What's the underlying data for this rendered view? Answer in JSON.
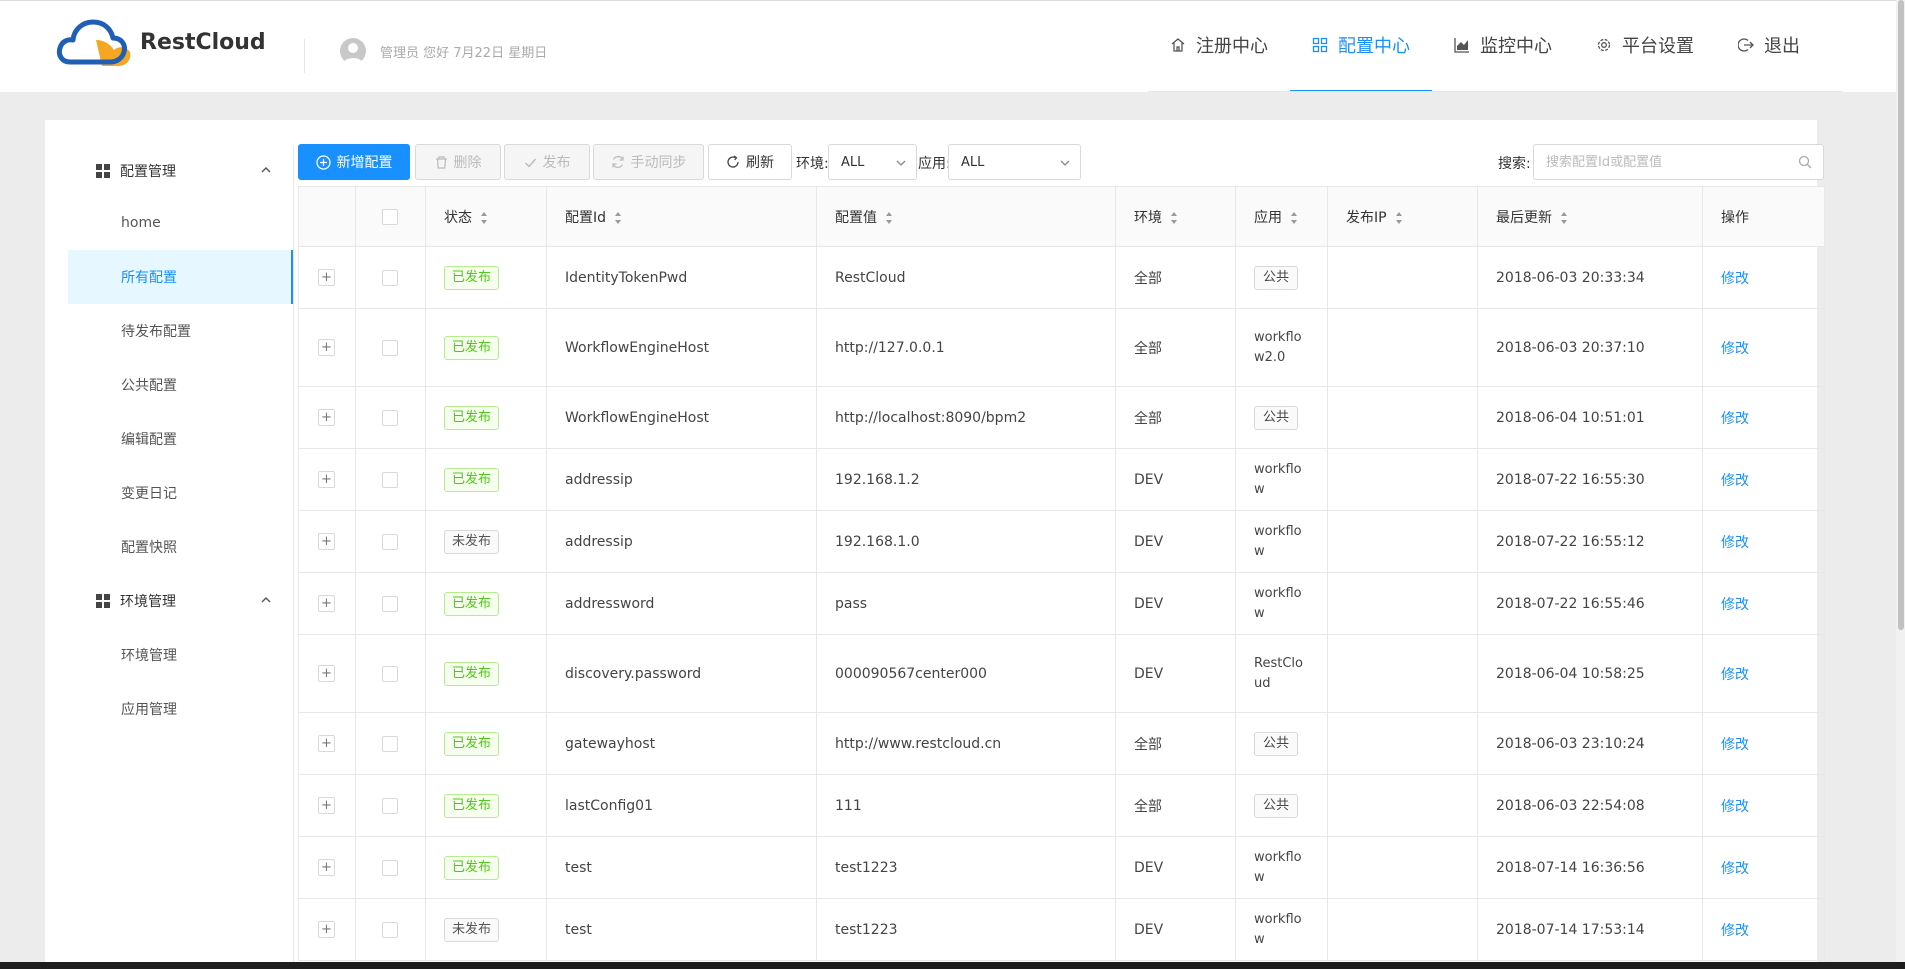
{
  "header": {
    "logo_text": "RestCloud",
    "greeting": "管理员 您好 7月22日 星期日",
    "nav": [
      {
        "label": "注册中心",
        "icon": "home-icon"
      },
      {
        "label": "配置中心",
        "icon": "appstore-icon",
        "active": true
      },
      {
        "label": "监控中心",
        "icon": "area-chart-icon"
      },
      {
        "label": "平台设置",
        "icon": "gear-icon"
      },
      {
        "label": "退出",
        "icon": "logout-icon"
      }
    ]
  },
  "sidebar": {
    "groups": [
      {
        "label": "配置管理",
        "icon": "appstore-icon",
        "items": [
          "home",
          "所有配置",
          "待发布配置",
          "公共配置",
          "编辑配置",
          "变更日记",
          "配置快照"
        ]
      },
      {
        "label": "环境管理",
        "icon": "appstore-icon",
        "items": [
          "环境管理",
          "应用管理"
        ]
      }
    ],
    "active_item": "所有配置"
  },
  "toolbar": {
    "add_label": "新增配置",
    "delete_label": "删除",
    "publish_label": "发布",
    "sync_label": "手动同步",
    "refresh_label": "刷新",
    "env_label": "环境:",
    "env_value": "ALL",
    "app_label": "应用:",
    "app_value": "ALL",
    "search_label": "搜索:",
    "search_placeholder": "搜索配置Id或配置值"
  },
  "table": {
    "columns": [
      "状态",
      "配置Id",
      "配置值",
      "环境",
      "应用",
      "发布IP",
      "最后更新",
      "操作"
    ],
    "action_label": "修改",
    "rows": [
      {
        "status": "已发布",
        "id": "IdentityTokenPwd",
        "value": "RestCloud",
        "env": "全部",
        "app": "公共",
        "app_tag": true,
        "ip": "",
        "updated": "2018-06-03 20:33:34"
      },
      {
        "status": "已发布",
        "id": "WorkflowEngineHost",
        "value": "http://127.0.0.1",
        "env": "全部",
        "app": "workflow2.0",
        "app_tag": false,
        "ip": "",
        "updated": "2018-06-03 20:37:10",
        "tall": true
      },
      {
        "status": "已发布",
        "id": "WorkflowEngineHost",
        "value": "http://localhost:8090/bpm2",
        "env": "全部",
        "app": "公共",
        "app_tag": true,
        "ip": "",
        "updated": "2018-06-04 10:51:01"
      },
      {
        "status": "已发布",
        "id": "addressip",
        "value": "192.168.1.2",
        "env": "DEV",
        "app": "workflow",
        "app_tag": false,
        "ip": "",
        "updated": "2018-07-22 16:55:30"
      },
      {
        "status": "未发布",
        "id": "addressip",
        "value": "192.168.1.0",
        "env": "DEV",
        "app": "workflow",
        "app_tag": false,
        "ip": "",
        "updated": "2018-07-22 16:55:12"
      },
      {
        "status": "已发布",
        "id": "addressword",
        "value": "pass",
        "env": "DEV",
        "app": "workflow",
        "app_tag": false,
        "ip": "",
        "updated": "2018-07-22 16:55:46"
      },
      {
        "status": "已发布",
        "id": "discovery.password",
        "value": "000090567center000",
        "env": "DEV",
        "app": "RestCloud",
        "app_tag": false,
        "ip": "",
        "updated": "2018-06-04 10:58:25",
        "tall": true
      },
      {
        "status": "已发布",
        "id": "gatewayhost",
        "value": "http://www.restcloud.cn",
        "env": "全部",
        "app": "公共",
        "app_tag": true,
        "ip": "",
        "updated": "2018-06-03 23:10:24"
      },
      {
        "status": "已发布",
        "id": "lastConfig01",
        "value": "111",
        "env": "全部",
        "app": "公共",
        "app_tag": true,
        "ip": "",
        "updated": "2018-06-03 22:54:08"
      },
      {
        "status": "已发布",
        "id": "test",
        "value": "test1223",
        "env": "DEV",
        "app": "workflow",
        "app_tag": false,
        "ip": "",
        "updated": "2018-07-14 16:36:56"
      },
      {
        "status": "未发布",
        "id": "test",
        "value": "test1223",
        "env": "DEV",
        "app": "workflow",
        "app_tag": false,
        "ip": "",
        "updated": "2018-07-14 17:53:14"
      }
    ]
  },
  "colors": {
    "accent": "#1890ff",
    "published_green": "#52c41a",
    "logo_blue": "#1f5fb4",
    "logo_orange": "#f5a623"
  }
}
